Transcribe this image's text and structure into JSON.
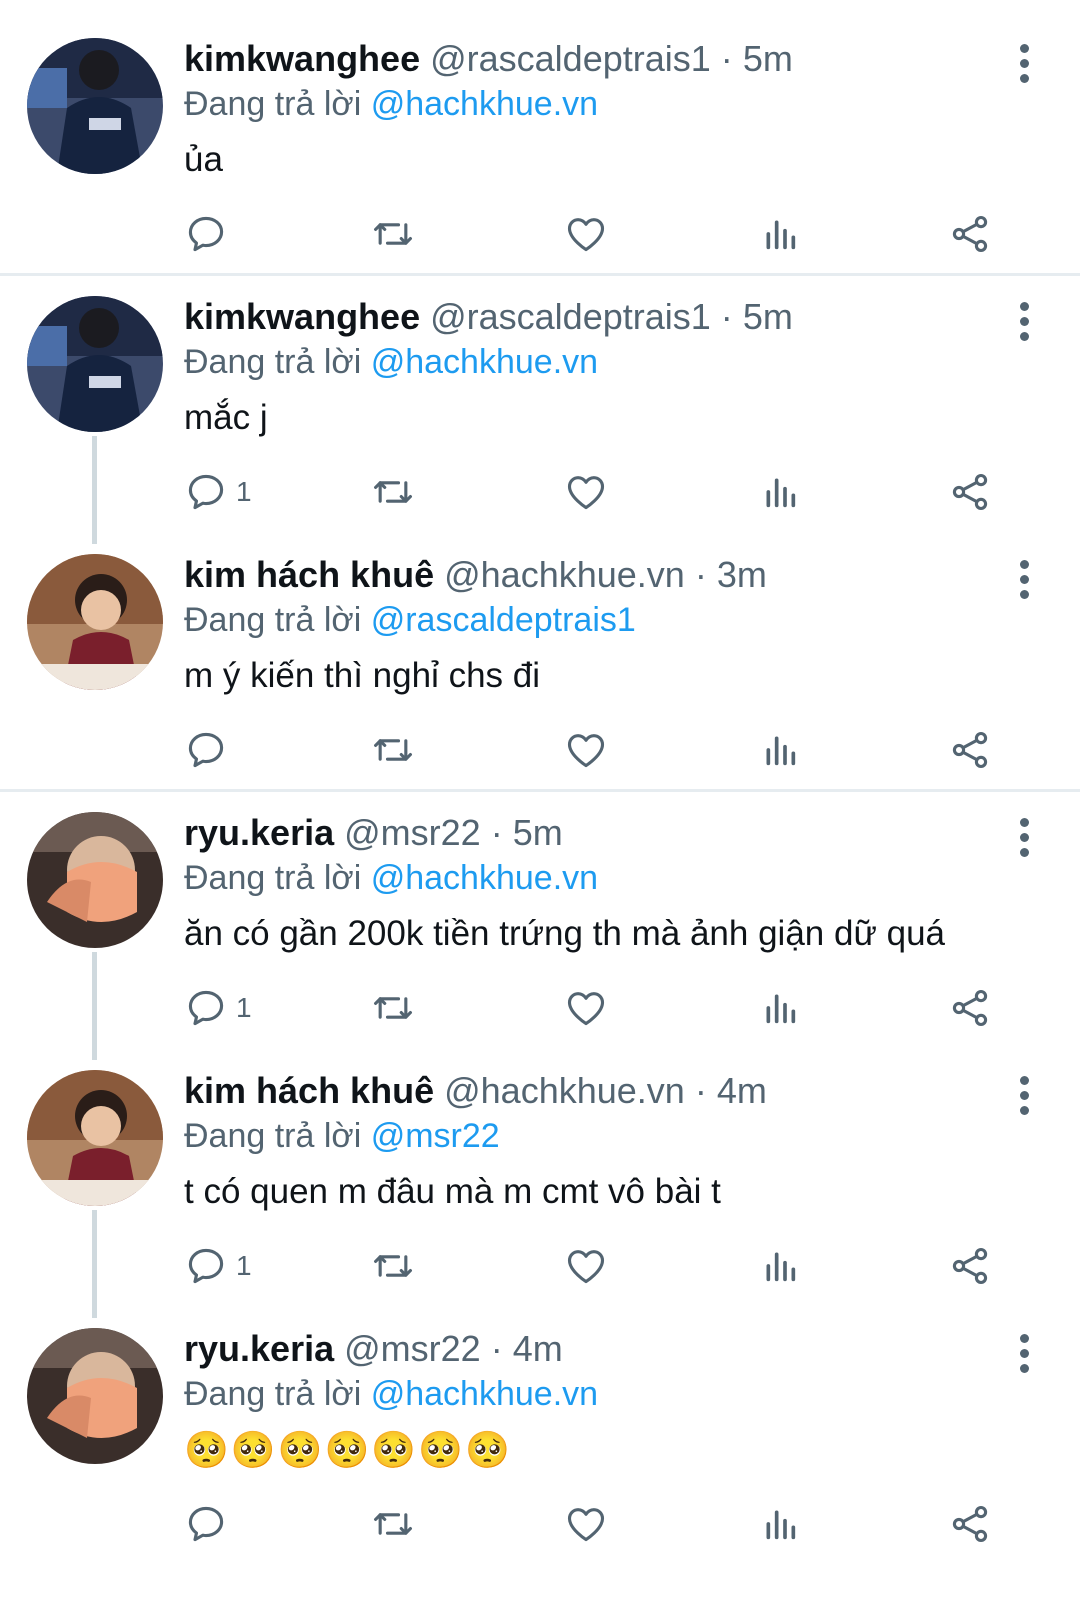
{
  "colors": {
    "accent": "#1d9bf0",
    "secondary_text": "#536471",
    "divider": "#e6ecf0"
  },
  "reply_prefix": "Đang trả lời",
  "tweets": [
    {
      "name": "kimkwanghee",
      "handle": "@rascaldeptrais1",
      "time": "5m",
      "reply_to": "@hachkhue.vn",
      "text": "ủa",
      "reply_count": "",
      "avatar": "avatar-kimkwanghee"
    },
    {
      "name": "kimkwanghee",
      "handle": "@rascaldeptrais1",
      "time": "5m",
      "reply_to": "@hachkhue.vn",
      "text": "mắc j",
      "reply_count": "1",
      "avatar": "avatar-kimkwanghee"
    },
    {
      "name": "kim hách khuê",
      "handle": "@hachkhue.vn",
      "time": "3m",
      "reply_to": "@rascaldeptrais1",
      "text": "m ý kiến thì nghỉ chs đi",
      "reply_count": "",
      "avatar": "avatar-hachkhue"
    },
    {
      "name": "ryu.keria",
      "handle": "@msr22",
      "time": "5m",
      "reply_to": "@hachkhue.vn",
      "text": "ăn có gần 200k tiền trứng th mà ảnh giận dữ quá",
      "reply_count": "1",
      "avatar": "avatar-keria"
    },
    {
      "name": "kim hách khuê",
      "handle": "@hachkhue.vn",
      "time": "4m",
      "reply_to": "@msr22",
      "text": "t có quen m đâu mà m cmt vô bài t",
      "reply_count": "1",
      "avatar": "avatar-hachkhue"
    },
    {
      "name": "ryu.keria",
      "handle": "@msr22",
      "time": "4m",
      "reply_to": "@hachkhue.vn",
      "text": "🥺🥺🥺🥺🥺🥺🥺",
      "reply_count": "",
      "avatar": "avatar-keria"
    }
  ],
  "action_icons": [
    "reply-icon",
    "retweet-icon",
    "like-icon",
    "analytics-icon",
    "share-icon"
  ]
}
